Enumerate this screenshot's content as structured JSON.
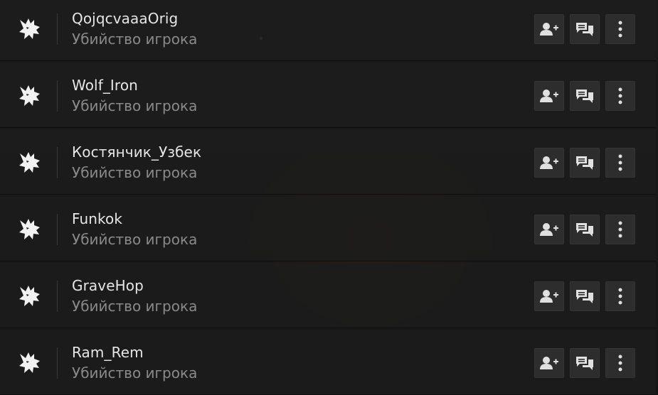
{
  "players": [
    {
      "name": "QojqcvaaaOrig",
      "status": "Убийство игрока"
    },
    {
      "name": "Wolf_Iron",
      "status": "Убийство игрока"
    },
    {
      "name": "Костянчик_Узбек",
      "status": "Убийство игрока"
    },
    {
      "name": "Funkok",
      "status": "Убийство игрока"
    },
    {
      "name": "GraveHop",
      "status": "Убийство игрока"
    },
    {
      "name": "Ram_Rem",
      "status": "Убийство игрока"
    }
  ],
  "icons": {
    "avatar": "wolf-logo-icon",
    "add_friend": "add-friend-icon",
    "chat": "chat-icon",
    "more": "more-vertical-icon"
  }
}
